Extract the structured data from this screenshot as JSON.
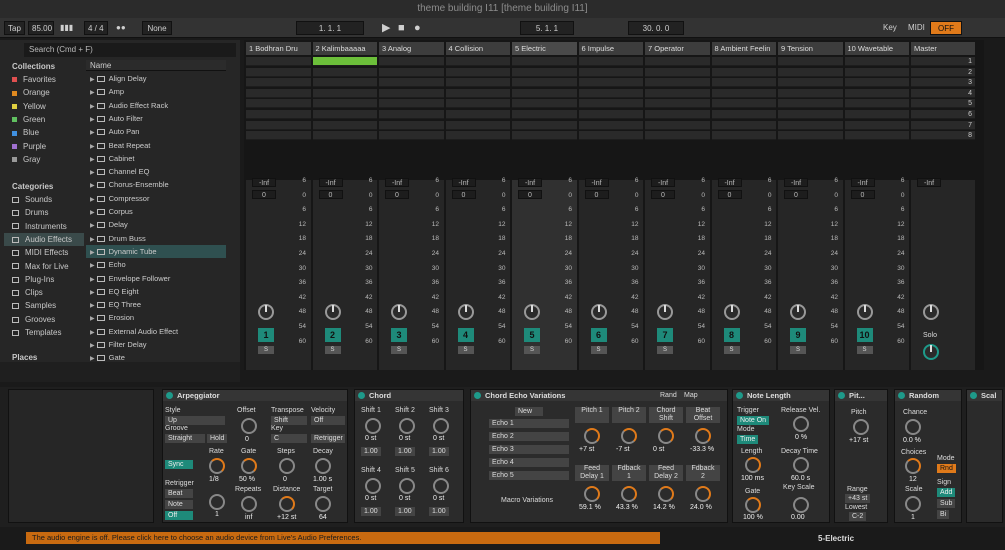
{
  "window": {
    "title": "theme building I11  [theme building I11]"
  },
  "toolbar": {
    "tap": "Tap",
    "tempo": "85.00",
    "signature": "4 / 4",
    "metronome": "●●",
    "quantize": "None",
    "position": "1.  1.  1",
    "loop_start": "5.  1.  1",
    "loop_length": "30.  0.  0",
    "key": "Key",
    "midi": "MIDI",
    "off": "OFF"
  },
  "browser": {
    "search_placeholder": "Search (Cmd + F)",
    "collections_title": "Collections",
    "collections": [
      {
        "label": "Favorites",
        "color": "#e05050"
      },
      {
        "label": "Orange",
        "color": "#e08a20"
      },
      {
        "label": "Yellow",
        "color": "#e0d040"
      },
      {
        "label": "Green",
        "color": "#60c060"
      },
      {
        "label": "Blue",
        "color": "#4090e0"
      },
      {
        "label": "Purple",
        "color": "#a070d0"
      },
      {
        "label": "Gray",
        "color": "#999999"
      }
    ],
    "categories_title": "Categories",
    "categories": [
      "Sounds",
      "Drums",
      "Instruments",
      "Audio Effects",
      "MIDI Effects",
      "Max for Live",
      "Plug-Ins",
      "Clips",
      "Samples",
      "Grooves",
      "Templates"
    ],
    "places_title": "Places",
    "name_header": "Name",
    "items": [
      "Align Delay",
      "Amp",
      "Audio Effect Rack",
      "Auto Filter",
      "Auto Pan",
      "Beat Repeat",
      "Cabinet",
      "Channel EQ",
      "Chorus-Ensemble",
      "Compressor",
      "Corpus",
      "Delay",
      "Drum Buss",
      "Dynamic Tube",
      "Echo",
      "Envelope Follower",
      "EQ Eight",
      "EQ Three",
      "Erosion",
      "External Audio Effect",
      "Filter Delay",
      "Gate"
    ]
  },
  "tracks": [
    {
      "name": "1 Bodhran Dru",
      "num": "1"
    },
    {
      "name": "2 Kalimbaaaaa",
      "num": "2"
    },
    {
      "name": "3 Analog",
      "num": "3"
    },
    {
      "name": "4 Collision",
      "num": "4"
    },
    {
      "name": "5 Electric",
      "num": "5"
    },
    {
      "name": "6 Impulse",
      "num": "6"
    },
    {
      "name": "7 Operator",
      "num": "7"
    },
    {
      "name": "8 Ambient Feelin",
      "num": "8"
    },
    {
      "name": "9 Tension",
      "num": "9"
    },
    {
      "name": "10 Wavetable",
      "num": "10"
    }
  ],
  "master": {
    "name": "Master",
    "scenes": [
      "1",
      "2",
      "3",
      "4",
      "5",
      "6",
      "7",
      "8"
    ],
    "solo": "Solo"
  },
  "mixer": {
    "inf": "-Inf",
    "zero": "0",
    "ticks": [
      "6",
      "0",
      "6",
      "12",
      "18",
      "24",
      "30",
      "36",
      "42",
      "48",
      "54",
      "60"
    ],
    "s": "S"
  },
  "devices": {
    "arp": {
      "title": "Arpeggiator",
      "style": "Style",
      "style_val": "Up",
      "groove": "Groove",
      "groove_val": "Straight",
      "hold": "Hold",
      "offset": "Offset",
      "offset_val": "0",
      "transpose": "Transpose",
      "transpose_val": "Shift",
      "key": "Key",
      "key_val": "C",
      "velocity": "Velocity",
      "velocity_val": "Off",
      "retrigger_btn": "Retrigger",
      "sync": "Sync",
      "rate": "Rate",
      "rate_val": "1/8",
      "gate": "Gate",
      "gate_val": "50 %",
      "steps": "Steps",
      "steps_val": "0",
      "decay": "Decay",
      "decay_val": "1.00 s",
      "retrigger": "Retrigger",
      "beat": "Beat",
      "note": "Note",
      "off": "Off",
      "retrig_val": "1",
      "repeats": "Repeats",
      "repeats_val": "inf",
      "distance": "Distance",
      "distance_val": "+12 st",
      "target": "Target",
      "target_val": "64"
    },
    "chord": {
      "title": "Chord",
      "shifts": [
        "Shift 1",
        "Shift 2",
        "Shift 3",
        "Shift 4",
        "Shift 5",
        "Shift 6"
      ],
      "st": "0 st",
      "amt": "1.00"
    },
    "rack": {
      "title": "Chord Echo Variations",
      "rand": "Rand",
      "map": "Map",
      "new": "New",
      "echoes": [
        "Echo 1",
        "Echo 2",
        "Echo 3",
        "Echo 4",
        "Echo 5"
      ],
      "macro": "Macro Variations",
      "macros": [
        {
          "label": "Pitch 1",
          "val": "+7 st"
        },
        {
          "label": "Pitch 2",
          "val": "-7 st"
        },
        {
          "label": "Chord Shift",
          "val": "0 st"
        },
        {
          "label": "Beat Offset",
          "val": "-33.3 %"
        },
        {
          "label": "Feed Delay 1",
          "val": "59.1 %"
        },
        {
          "label": "Fdback 1",
          "val": "43.3 %"
        },
        {
          "label": "Feed Delay 2",
          "val": "14.2 %"
        },
        {
          "label": "Fdback 2",
          "val": "24.0 %"
        }
      ]
    },
    "notelen": {
      "title": "Note Length",
      "trigger": "Trigger",
      "trigger_val": "Note On",
      "release": "Release Vel.",
      "release_val": "0 %",
      "mode": "Mode",
      "mode_val": "Time",
      "length": "Length",
      "length_val": "100 ms",
      "decay": "Decay Time",
      "decay_val": "60.0 s",
      "gate": "Gate",
      "gate_val": "100 %",
      "keyscale": "Key Scale",
      "keyscale_val": "0.00"
    },
    "pitch": {
      "title": "Pit...",
      "pitch": "Pitch",
      "pitch_val": "+17 st",
      "range": "Range",
      "range_val": "+43 st",
      "lowest": "Lowest",
      "lowest_val": "C-2"
    },
    "random": {
      "title": "Random",
      "chance": "Chance",
      "chance_val": "0.0 %",
      "choices": "Choices",
      "choices_val": "12",
      "mode": "Mode",
      "mode_val": "Rnd",
      "scale": "Scale",
      "scale_val": "1",
      "sign": "Sign",
      "add": "Add",
      "sub": "Sub",
      "bi": "Bi"
    },
    "scale": {
      "title": "Scal"
    }
  },
  "status": {
    "message": "The audio engine is off. Please click here to choose an audio device from Live's Audio Preferences.",
    "track": "5-Electric"
  }
}
